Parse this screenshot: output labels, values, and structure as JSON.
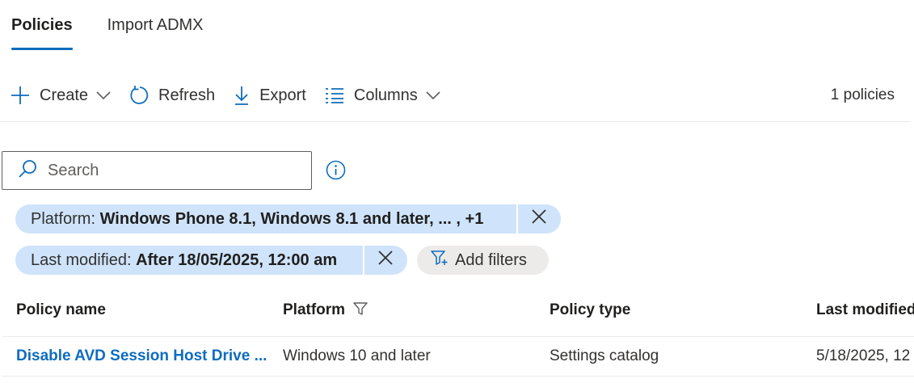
{
  "tabs": [
    {
      "label": "Policies",
      "active": true
    },
    {
      "label": "Import ADMX",
      "active": false
    }
  ],
  "toolbar": {
    "create_label": "Create",
    "refresh_label": "Refresh",
    "export_label": "Export",
    "columns_label": "Columns",
    "count_text": "1 policies"
  },
  "search": {
    "placeholder": "Search"
  },
  "filters": {
    "platform": {
      "key": "Platform:",
      "value": "Windows Phone 8.1, Windows 8.1 and later, ...    , +1"
    },
    "last_modified": {
      "key": "Last modified:",
      "value": "After 18/05/2025, 12:00 am"
    },
    "add_label": "Add filters"
  },
  "table": {
    "columns": [
      "Policy name",
      "Platform",
      "Policy type",
      "Last modified"
    ],
    "rows": [
      {
        "name": "Disable AVD Session Host Drive ...",
        "platform": "Windows 10 and later",
        "type": "Settings catalog",
        "modified": "5/18/2025, 12"
      }
    ]
  },
  "colors": {
    "accent": "#0f6cbd",
    "pill_bg": "#cfe4fa",
    "add_filter_bg": "#edebe9"
  },
  "icons": [
    "plus-icon",
    "chevron-down-icon",
    "refresh-icon",
    "download-icon",
    "columns-list-icon",
    "search-icon",
    "info-icon",
    "close-icon",
    "filter-add-icon",
    "filter-icon"
  ]
}
